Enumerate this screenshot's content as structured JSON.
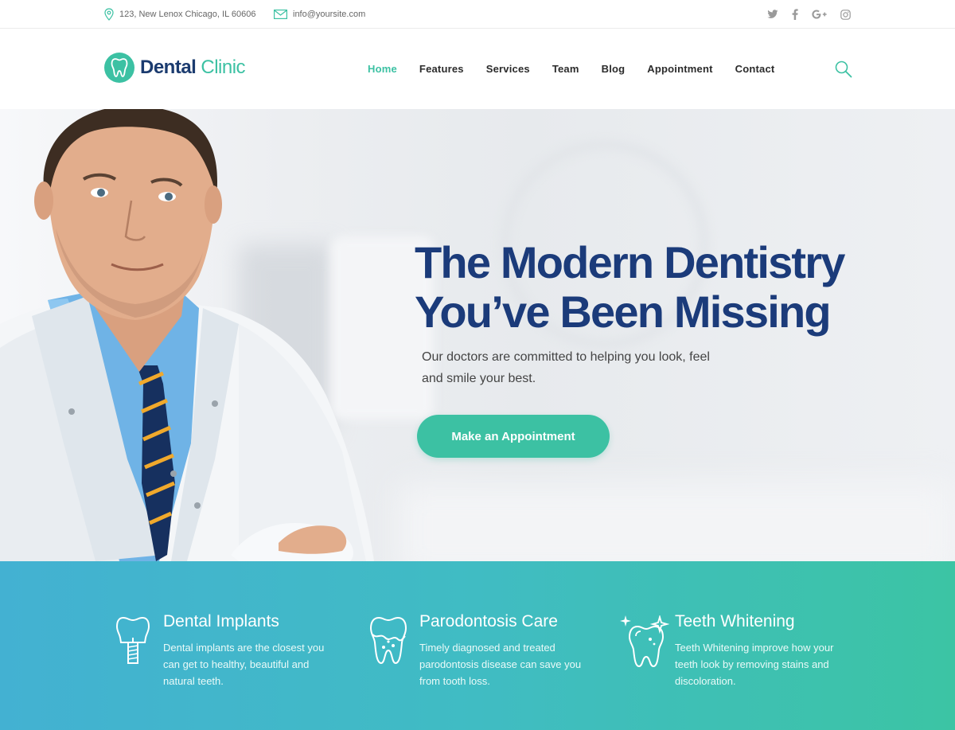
{
  "topbar": {
    "address": "123, New Lenox Chicago, IL 60606",
    "email": "info@yoursite.com",
    "socials": [
      "twitter-icon",
      "facebook-icon",
      "google-plus-icon",
      "instagram-icon"
    ]
  },
  "header": {
    "logo_bold": "Dental",
    "logo_light": "Clinic",
    "nav": [
      "Home",
      "Features",
      "Services",
      "Team",
      "Blog",
      "Appointment",
      "Contact"
    ],
    "active_nav": "Home"
  },
  "hero": {
    "title_line1": "The Modern Dentistry",
    "title_line2": "You’ve Been Missing",
    "subtitle_line1": "Our doctors are committed to helping you look, feel",
    "subtitle_line2": "and smile your best.",
    "cta_label": "Make an Appointment"
  },
  "features": [
    {
      "title": "Dental Implants",
      "text": "Dental implants are the closest you can get to healthy, beautiful and natural teeth.",
      "icon": "tooth-implant-icon"
    },
    {
      "title": "Parodontosis Care",
      "text": "Timely diagnosed and treated parodontosis disease can save you from tooth loss.",
      "icon": "tooth-care-icon"
    },
    {
      "title": "Teeth Whitening",
      "text": "Teeth Whitening improve how your teeth look by removing stains and discoloration.",
      "icon": "tooth-sparkle-icon"
    }
  ],
  "colors": {
    "accent": "#3cc1a3",
    "navy": "#1b3b7a",
    "feature_gradient_start": "#43b1d2",
    "feature_gradient_end": "#3cc4a4"
  }
}
